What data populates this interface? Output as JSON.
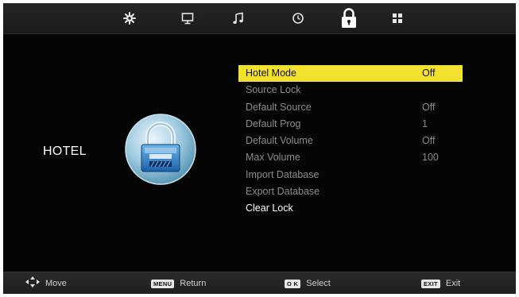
{
  "tabs": [
    {
      "name": "settings-icon"
    },
    {
      "name": "picture-icon"
    },
    {
      "name": "sound-icon"
    },
    {
      "name": "time-icon"
    },
    {
      "name": "lock-icon",
      "active": true
    },
    {
      "name": "app-grid-icon"
    }
  ],
  "section": {
    "title": "HOTEL"
  },
  "menu": {
    "items": [
      {
        "label": "Hotel Mode",
        "value": "Off"
      },
      {
        "label": "Source Lock",
        "value": ""
      },
      {
        "label": "Default Source",
        "value": "Off"
      },
      {
        "label": "Default Prog",
        "value": "1"
      },
      {
        "label": "Default Volume",
        "value": "Off"
      },
      {
        "label": "Max Volume",
        "value": "100"
      },
      {
        "label": "Import Database",
        "value": ""
      },
      {
        "label": "Export Database",
        "value": ""
      },
      {
        "label": "Clear Lock",
        "value": ""
      }
    ]
  },
  "footer": {
    "move": {
      "label": "Move",
      "icon": "dpad-icon"
    },
    "ret": {
      "key": "MENU",
      "label": "Return"
    },
    "select": {
      "key": "O K",
      "label": "Select"
    },
    "exit": {
      "key": "EXIT",
      "label": "Exit"
    }
  },
  "colors": {
    "highlight": "#f2e12d",
    "background": "#050505",
    "inactive_text": "#8a8a8a",
    "active_text": "#ffffff"
  }
}
